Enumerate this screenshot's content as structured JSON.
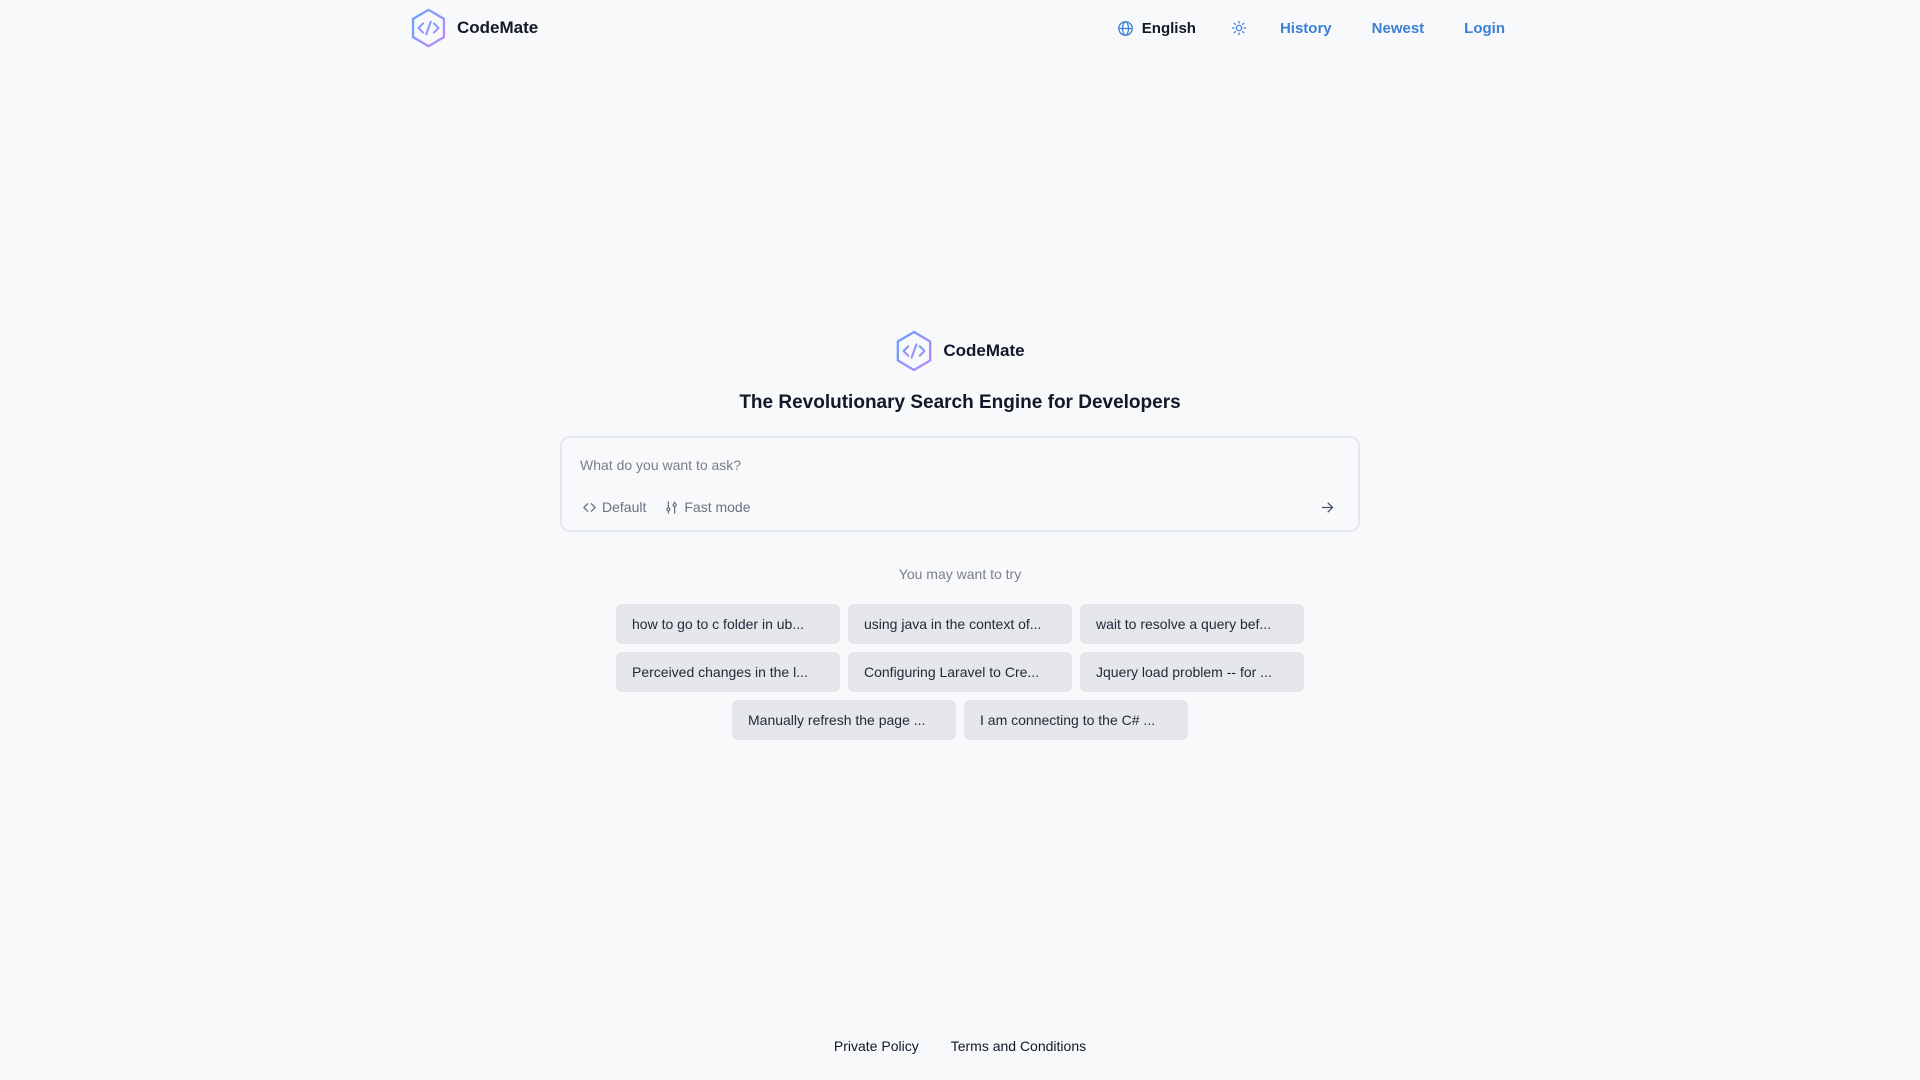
{
  "header": {
    "brand": {
      "name": "CodeMate",
      "icon": "codemate-hexagon-logo"
    },
    "language": {
      "label": "English",
      "icon": "globe-icon"
    },
    "theme_toggle": {
      "icon": "sun-icon"
    },
    "nav": {
      "history": "History",
      "newest": "Newest",
      "login": "Login"
    }
  },
  "hero": {
    "brand_name": "CodeMate",
    "tagline": "The Revolutionary Search Engine for Developers"
  },
  "search": {
    "placeholder": "What do you want to ask?",
    "value": "",
    "mode_default": {
      "label": "Default",
      "icon": "code-brackets-icon"
    },
    "mode_fast": {
      "label": "Fast mode",
      "icon": "sliders-icon"
    },
    "submit_icon": "arrow-right-icon"
  },
  "suggestions": {
    "label": "You may want to try",
    "items": [
      "how to go to c folder in ub...",
      "using java in the context of...",
      "wait to resolve a query bef...",
      "Perceived changes in the l...",
      "Configuring Laravel to Cre...",
      "Jquery load problem -- for ...",
      "Manually refresh the page ...",
      "I am connecting to the C# ..."
    ]
  },
  "footer": {
    "privacy": "Private Policy",
    "terms": "Terms and Conditions"
  },
  "colors": {
    "background": "#f8f9fb",
    "link": "#3b7fd6",
    "chip": "#e5e7eb",
    "logo_gradient_start": "#60a5fa",
    "logo_gradient_end": "#c084fc"
  }
}
